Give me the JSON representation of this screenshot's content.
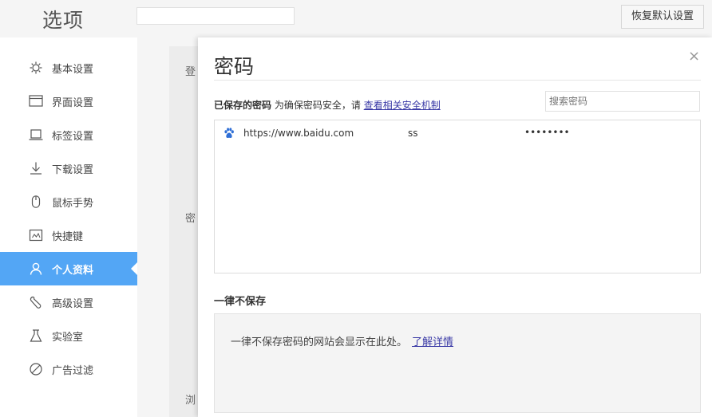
{
  "header": {
    "title": "选项",
    "search_placeholder": "",
    "reset_label": "恢复默认设置"
  },
  "sidebar": {
    "items": [
      {
        "label": "基本设置",
        "icon": "gear-icon"
      },
      {
        "label": "界面设置",
        "icon": "window-icon"
      },
      {
        "label": "标签设置",
        "icon": "laptop-icon"
      },
      {
        "label": "下载设置",
        "icon": "download-icon"
      },
      {
        "label": "鼠标手势",
        "icon": "mouse-icon"
      },
      {
        "label": "快捷键",
        "icon": "keyboard-icon"
      },
      {
        "label": "个人资料",
        "icon": "user-icon",
        "active": true
      },
      {
        "label": "高级设置",
        "icon": "wrench-icon"
      },
      {
        "label": "实验室",
        "icon": "flask-icon"
      },
      {
        "label": "广告过滤",
        "icon": "block-icon"
      }
    ],
    "active_color": "#53a6f5"
  },
  "background_labels": [
    "登",
    "密",
    "浏"
  ],
  "dialog": {
    "title": "密码",
    "close_label": "×",
    "saved": {
      "heading": "已保存的密码",
      "description": "为确保密码安全，请",
      "link": "查看相关安全机制"
    },
    "search_placeholder": "搜索密码",
    "passwords": [
      {
        "site": "https://www.baidu.com",
        "username": "ss",
        "password": "••••••••",
        "icon": "baidu-paw-icon"
      }
    ],
    "never": {
      "heading": "一律不保存",
      "message": "一律不保存密码的网站会显示在此处。",
      "link": "了解详情"
    }
  }
}
